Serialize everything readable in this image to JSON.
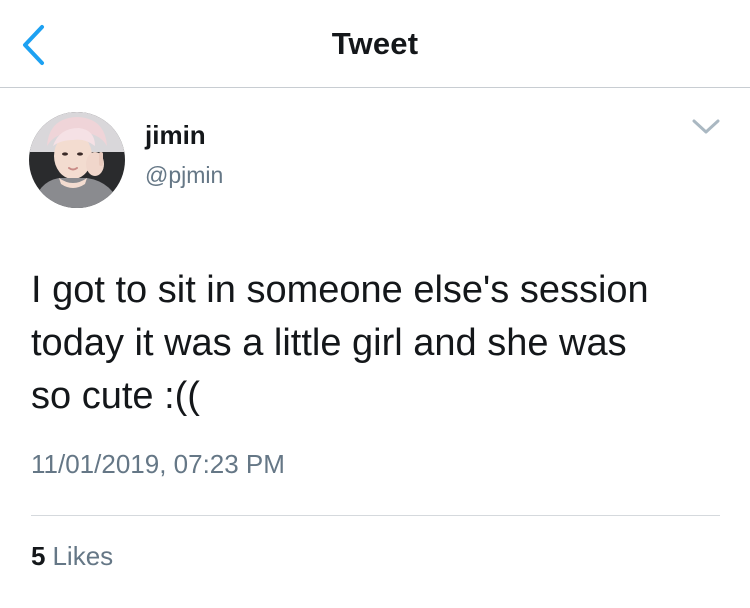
{
  "header": {
    "title": "Tweet",
    "back_icon": "chevron-left-icon",
    "accent_color": "#1da1f2"
  },
  "tweet": {
    "author": {
      "display_name": "jimin",
      "handle": "@pjmin",
      "avatar": "profile-photo"
    },
    "more_icon": "chevron-down-icon",
    "text": "I got to sit in someone else's session\ntoday it was a little girl and she was\nso cute :((",
    "timestamp": "11/01/2019, 07:23 PM",
    "likes": {
      "count": "5",
      "label": "Likes"
    }
  }
}
